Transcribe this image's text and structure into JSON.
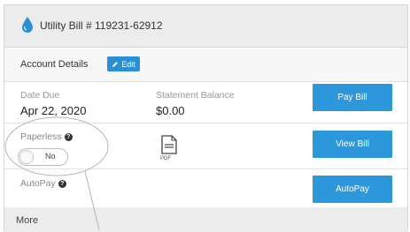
{
  "header": {
    "title": "Utility Bill # 119231-62912",
    "icon": "water-drop-icon"
  },
  "account": {
    "label": "Account Details",
    "edit_label": "Edit"
  },
  "due": {
    "label": "Date Due",
    "value": "Apr 22, 2020"
  },
  "balance": {
    "label": "Statement Balance",
    "value": "$0.00"
  },
  "paperless": {
    "label": "Paperless",
    "toggle_text": "No"
  },
  "autopay": {
    "label": "AutoPay"
  },
  "pdf": {
    "label": "PDF"
  },
  "buttons": {
    "pay": "Pay Bill",
    "view": "View Bill",
    "autopay": "AutoPay"
  },
  "more": {
    "label": "More"
  },
  "colors": {
    "accent": "#2d97dc",
    "header_bg": "#ececec",
    "drop": "#2a8fd4"
  }
}
